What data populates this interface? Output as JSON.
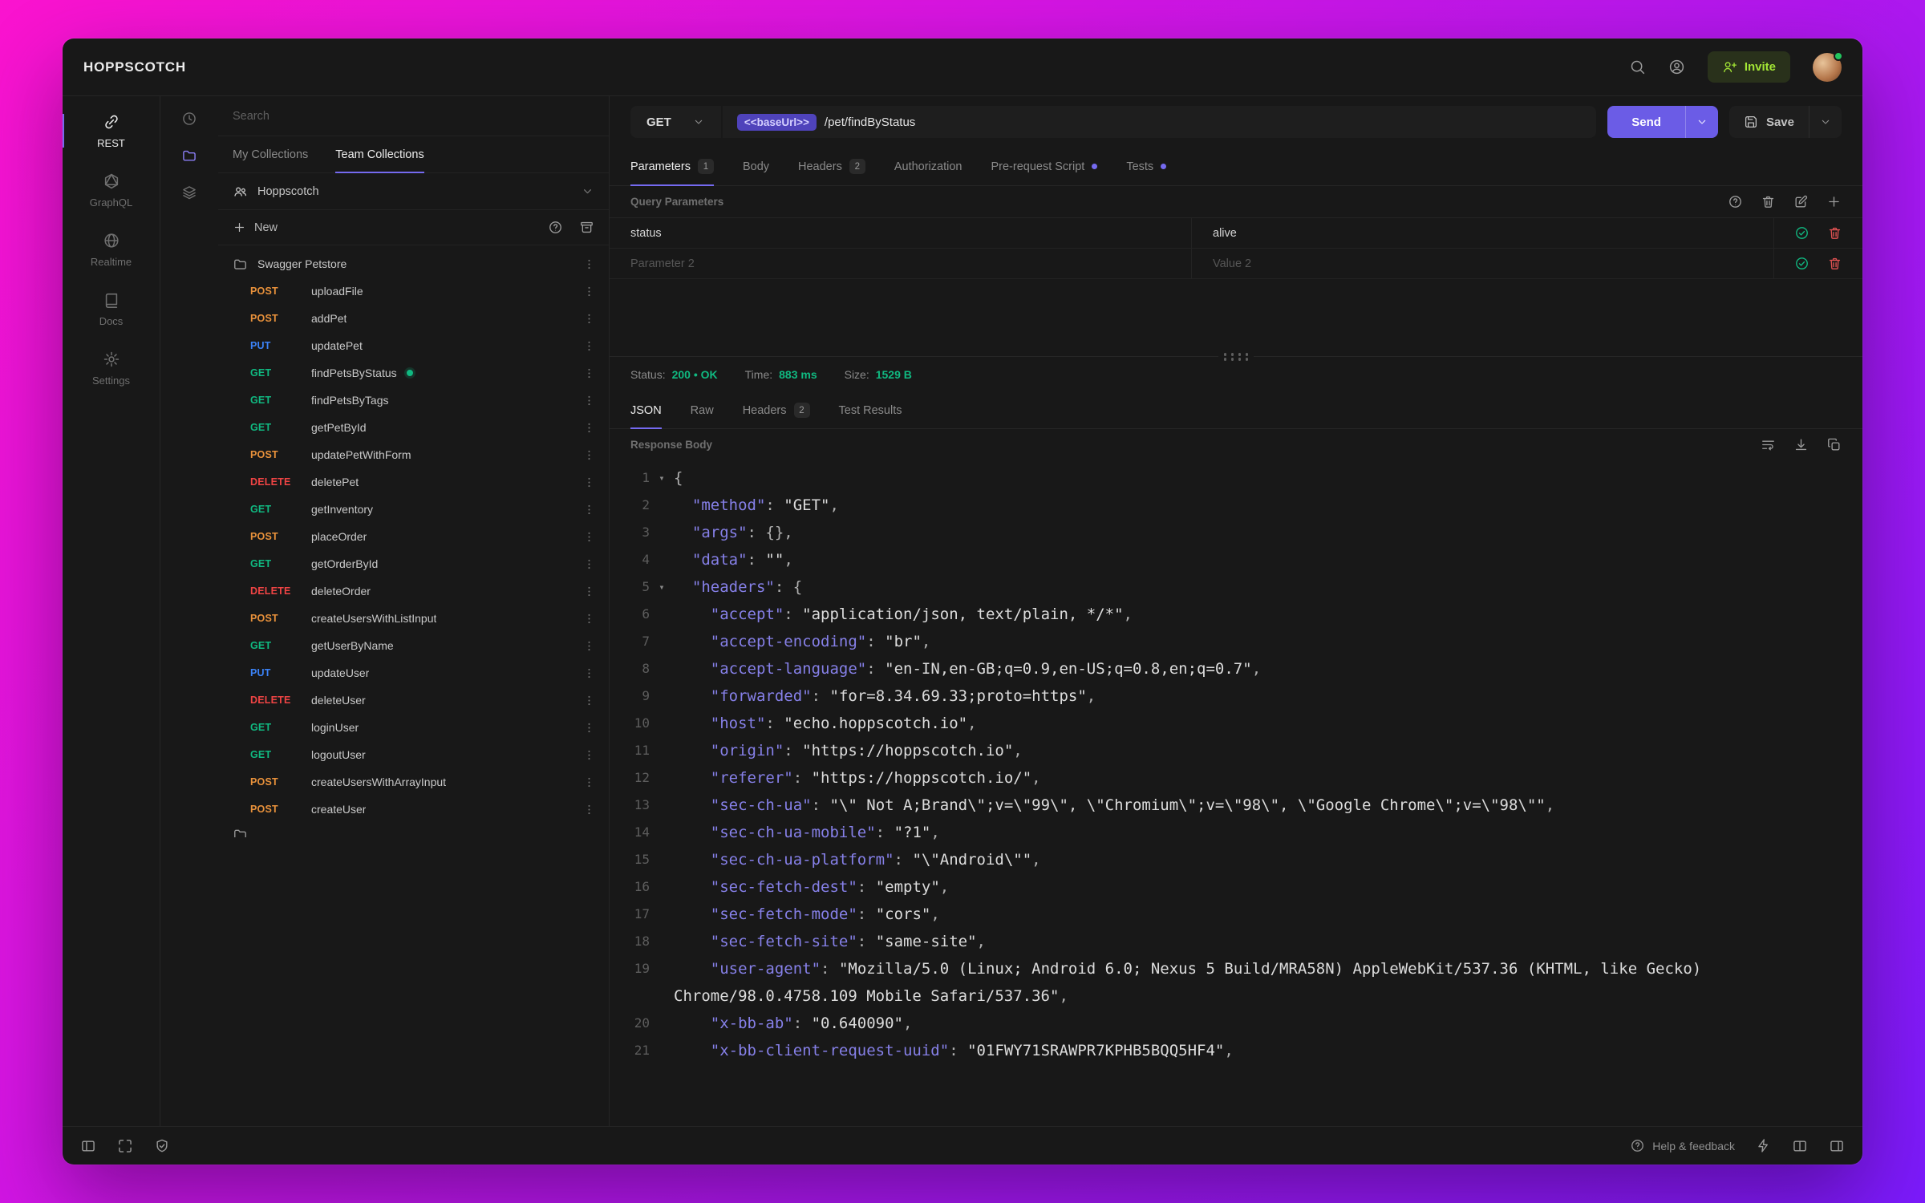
{
  "colors": {
    "accent": "#756af0",
    "send": "#6b5ce6",
    "invite": "#a3e635",
    "success": "#10b981",
    "method_get": "#10b981",
    "method_post": "#e8913b",
    "method_put": "#3b82f6",
    "method_delete": "#ef4444"
  },
  "icons": {
    "search-icon": "magnifier",
    "account-icon": "person-in-circle",
    "invite-user-icon": "person-plus",
    "history-icon": "clock",
    "collections-icon": "folder",
    "environments-icon": "layers",
    "more-options-icon": "vertical-ellipsis",
    "fold-caret": "▾"
  },
  "topbar": {
    "logo": "HOPPSCOTCH",
    "invite_label": "Invite"
  },
  "nav": {
    "items": [
      {
        "label": "REST",
        "icon": "link-icon",
        "active": true
      },
      {
        "label": "GraphQL",
        "icon": "graphql-icon"
      },
      {
        "label": "Realtime",
        "icon": "globe-icon"
      },
      {
        "label": "Docs",
        "icon": "book-icon"
      },
      {
        "label": "Settings",
        "icon": "gear-icon"
      }
    ]
  },
  "sidebar": {
    "search_placeholder": "Search",
    "tabs": [
      {
        "label": "My Collections"
      },
      {
        "label": "Team Collections",
        "active": true
      }
    ],
    "team_name": "Hoppscotch",
    "new_label": "New",
    "tree": [
      {
        "type": "folder",
        "label": "Swagger Petstore"
      },
      {
        "type": "request",
        "method": "POST",
        "label": "uploadFile"
      },
      {
        "type": "request",
        "method": "POST",
        "label": "addPet"
      },
      {
        "type": "request",
        "method": "PUT",
        "label": "updatePet"
      },
      {
        "type": "request",
        "method": "GET",
        "label": "findPetsByStatus",
        "active": true
      },
      {
        "type": "request",
        "method": "GET",
        "label": "findPetsByTags"
      },
      {
        "type": "request",
        "method": "GET",
        "label": "getPetById"
      },
      {
        "type": "request",
        "method": "POST",
        "label": "updatePetWithForm"
      },
      {
        "type": "request",
        "method": "DELETE",
        "label": "deletePet"
      },
      {
        "type": "request",
        "method": "GET",
        "label": "getInventory"
      },
      {
        "type": "request",
        "method": "POST",
        "label": "placeOrder"
      },
      {
        "type": "request",
        "method": "GET",
        "label": "getOrderById"
      },
      {
        "type": "request",
        "method": "DELETE",
        "label": "deleteOrder"
      },
      {
        "type": "request",
        "method": "POST",
        "label": "createUsersWithListInput"
      },
      {
        "type": "request",
        "method": "GET",
        "label": "getUserByName"
      },
      {
        "type": "request",
        "method": "PUT",
        "label": "updateUser"
      },
      {
        "type": "request",
        "method": "DELETE",
        "label": "deleteUser"
      },
      {
        "type": "request",
        "method": "GET",
        "label": "loginUser"
      },
      {
        "type": "request",
        "method": "GET",
        "label": "logoutUser"
      },
      {
        "type": "request",
        "method": "POST",
        "label": "createUsersWithArrayInput"
      },
      {
        "type": "request",
        "method": "POST",
        "label": "createUser"
      },
      {
        "type": "folder",
        "label": "",
        "partial": true
      }
    ]
  },
  "request": {
    "method": "GET",
    "base_url_chip": "<<baseUrl>>",
    "path": "/pet/findByStatus",
    "send_label": "Send",
    "save_label": "Save",
    "tabs": [
      {
        "label": "Parameters",
        "badge": "1",
        "active": true
      },
      {
        "label": "Body"
      },
      {
        "label": "Headers",
        "badge": "2"
      },
      {
        "label": "Authorization"
      },
      {
        "label": "Pre-request Script",
        "dot": true
      },
      {
        "label": "Tests",
        "dot": true
      }
    ],
    "section_title": "Query Parameters",
    "params": [
      {
        "key": "status",
        "value": "alive",
        "placeholder": false
      },
      {
        "key": "Parameter 2",
        "value": "Value 2",
        "placeholder": true
      }
    ]
  },
  "response": {
    "status_label": "Status:",
    "status_value": "200 • OK",
    "time_label": "Time:",
    "time_value": "883 ms",
    "size_label": "Size:",
    "size_value": "1529 B",
    "tabs": [
      {
        "label": "JSON",
        "active": true
      },
      {
        "label": "Raw"
      },
      {
        "label": "Headers",
        "badge": "2"
      },
      {
        "label": "Test Results"
      }
    ],
    "body_title": "Response Body",
    "code_lines": [
      {
        "n": 1,
        "fold": true,
        "parts": [
          [
            "pl",
            "{"
          ]
        ]
      },
      {
        "n": 2,
        "parts": [
          [
            "pl",
            "  "
          ],
          [
            "k",
            "\"method\""
          ],
          [
            "pl",
            ": "
          ],
          [
            "s",
            "\"GET\""
          ],
          [
            "pl",
            ","
          ]
        ]
      },
      {
        "n": 3,
        "parts": [
          [
            "pl",
            "  "
          ],
          [
            "k",
            "\"args\""
          ],
          [
            "pl",
            ": {},"
          ]
        ]
      },
      {
        "n": 4,
        "parts": [
          [
            "pl",
            "  "
          ],
          [
            "k",
            "\"data\""
          ],
          [
            "pl",
            ": "
          ],
          [
            "s",
            "\"\""
          ],
          [
            "pl",
            ","
          ]
        ]
      },
      {
        "n": 5,
        "fold": true,
        "parts": [
          [
            "pl",
            "  "
          ],
          [
            "k",
            "\"headers\""
          ],
          [
            "pl",
            ": {"
          ]
        ]
      },
      {
        "n": 6,
        "parts": [
          [
            "pl",
            "    "
          ],
          [
            "k",
            "\"accept\""
          ],
          [
            "pl",
            ": "
          ],
          [
            "s",
            "\"application/json, text/plain, */*\""
          ],
          [
            "pl",
            ","
          ]
        ]
      },
      {
        "n": 7,
        "parts": [
          [
            "pl",
            "    "
          ],
          [
            "k",
            "\"accept-encoding\""
          ],
          [
            "pl",
            ": "
          ],
          [
            "s",
            "\"br\""
          ],
          [
            "pl",
            ","
          ]
        ]
      },
      {
        "n": 8,
        "parts": [
          [
            "pl",
            "    "
          ],
          [
            "k",
            "\"accept-language\""
          ],
          [
            "pl",
            ": "
          ],
          [
            "s",
            "\"en-IN,en-GB;q=0.9,en-US;q=0.8,en;q=0.7\""
          ],
          [
            "pl",
            ","
          ]
        ]
      },
      {
        "n": 9,
        "parts": [
          [
            "pl",
            "    "
          ],
          [
            "k",
            "\"forwarded\""
          ],
          [
            "pl",
            ": "
          ],
          [
            "s",
            "\"for=8.34.69.33;proto=https\""
          ],
          [
            "pl",
            ","
          ]
        ]
      },
      {
        "n": 10,
        "parts": [
          [
            "pl",
            "    "
          ],
          [
            "k",
            "\"host\""
          ],
          [
            "pl",
            ": "
          ],
          [
            "s",
            "\"echo.hoppscotch.io\""
          ],
          [
            "pl",
            ","
          ]
        ]
      },
      {
        "n": 11,
        "parts": [
          [
            "pl",
            "    "
          ],
          [
            "k",
            "\"origin\""
          ],
          [
            "pl",
            ": "
          ],
          [
            "s",
            "\"https://hoppscotch.io\""
          ],
          [
            "pl",
            ","
          ]
        ]
      },
      {
        "n": 12,
        "parts": [
          [
            "pl",
            "    "
          ],
          [
            "k",
            "\"referer\""
          ],
          [
            "pl",
            ": "
          ],
          [
            "s",
            "\"https://hoppscotch.io/\""
          ],
          [
            "pl",
            ","
          ]
        ]
      },
      {
        "n": 13,
        "parts": [
          [
            "pl",
            "    "
          ],
          [
            "k",
            "\"sec-ch-ua\""
          ],
          [
            "pl",
            ": "
          ],
          [
            "s",
            "\"\\\" Not A;Brand\\\";v=\\\"99\\\", \\\"Chromium\\\";v=\\\"98\\\", \\\"Google Chrome\\\";v=\\\"98\\\"\""
          ],
          [
            "pl",
            ","
          ]
        ]
      },
      {
        "n": 14,
        "parts": [
          [
            "pl",
            "    "
          ],
          [
            "k",
            "\"sec-ch-ua-mobile\""
          ],
          [
            "pl",
            ": "
          ],
          [
            "s",
            "\"?1\""
          ],
          [
            "pl",
            ","
          ]
        ]
      },
      {
        "n": 15,
        "parts": [
          [
            "pl",
            "    "
          ],
          [
            "k",
            "\"sec-ch-ua-platform\""
          ],
          [
            "pl",
            ": "
          ],
          [
            "s",
            "\"\\\"Android\\\"\""
          ],
          [
            "pl",
            ","
          ]
        ]
      },
      {
        "n": 16,
        "parts": [
          [
            "pl",
            "    "
          ],
          [
            "k",
            "\"sec-fetch-dest\""
          ],
          [
            "pl",
            ": "
          ],
          [
            "s",
            "\"empty\""
          ],
          [
            "pl",
            ","
          ]
        ]
      },
      {
        "n": 17,
        "parts": [
          [
            "pl",
            "    "
          ],
          [
            "k",
            "\"sec-fetch-mode\""
          ],
          [
            "pl",
            ": "
          ],
          [
            "s",
            "\"cors\""
          ],
          [
            "pl",
            ","
          ]
        ]
      },
      {
        "n": 18,
        "parts": [
          [
            "pl",
            "    "
          ],
          [
            "k",
            "\"sec-fetch-site\""
          ],
          [
            "pl",
            ": "
          ],
          [
            "s",
            "\"same-site\""
          ],
          [
            "pl",
            ","
          ]
        ]
      },
      {
        "n": 19,
        "parts": [
          [
            "pl",
            "    "
          ],
          [
            "k",
            "\"user-agent\""
          ],
          [
            "pl",
            ": "
          ],
          [
            "s",
            "\"Mozilla/5.0 (Linux; Android 6.0; Nexus 5 Build/MRA58N) AppleWebKit/537.36 (KHTML, like Gecko) Chrome/98.0.4758.109 Mobile Safari/537.36\""
          ],
          [
            "pl",
            ","
          ]
        ]
      },
      {
        "n": 20,
        "parts": [
          [
            "pl",
            "    "
          ],
          [
            "k",
            "\"x-bb-ab\""
          ],
          [
            "pl",
            ": "
          ],
          [
            "s",
            "\"0.640090\""
          ],
          [
            "pl",
            ","
          ]
        ]
      },
      {
        "n": 21,
        "parts": [
          [
            "pl",
            "    "
          ],
          [
            "k",
            "\"x-bb-client-request-uuid\""
          ],
          [
            "pl",
            ": "
          ],
          [
            "s",
            "\"01FWY71SRAWPR7KPHB5BQQ5HF4\""
          ],
          [
            "pl",
            ","
          ]
        ]
      }
    ]
  },
  "statusbar": {
    "help_label": "Help & feedback"
  }
}
